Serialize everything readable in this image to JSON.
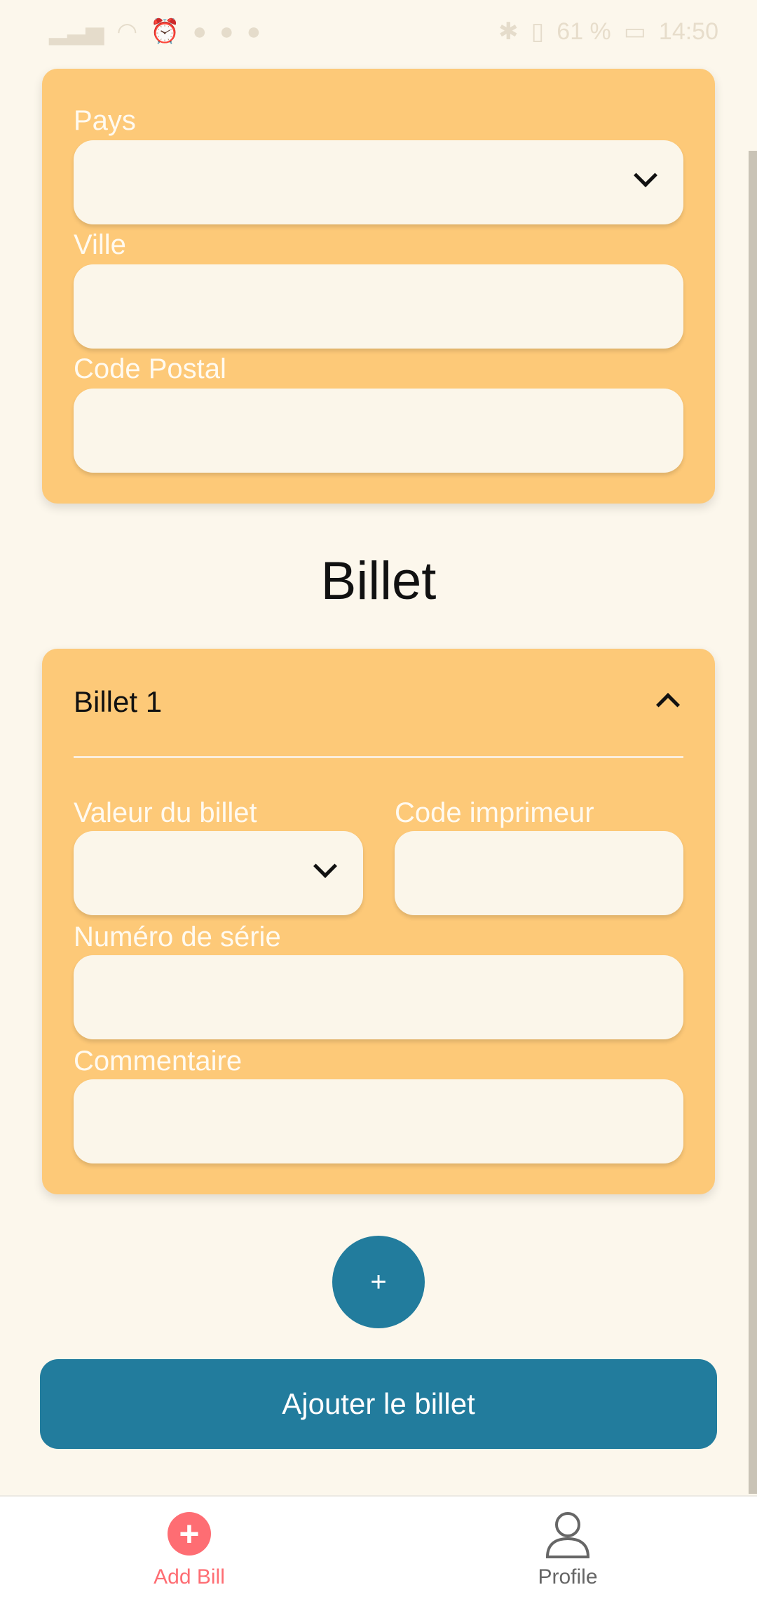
{
  "status_bar": {
    "left_icons": [
      "signal-icon",
      "wifi-icon",
      "alarm-icon",
      "fire-icon",
      "snapchat-icon",
      "messenger-icon"
    ],
    "right_icons": [
      "bluetooth-icon",
      "vibrate-icon"
    ],
    "battery": "61 %",
    "time": "14:50"
  },
  "address": {
    "country_label": "Pays",
    "city_label": "Ville",
    "postal_label": "Code Postal"
  },
  "section_title": "Billet",
  "bill": {
    "header": "Billet 1",
    "value_label": "Valeur du billet",
    "printer_code_label": "Code imprimeur",
    "serial_label": "Numéro de série",
    "comment_label": "Commentaire"
  },
  "actions": {
    "add_symbol": "+",
    "submit_label": "Ajouter le billet"
  },
  "bottom_nav": {
    "add_label": "Add Bill",
    "profile_label": "Profile"
  },
  "colors": {
    "background": "#fcf7ec",
    "card": "#fdc978",
    "primary": "#227c9d",
    "accent": "#fe6d73"
  }
}
